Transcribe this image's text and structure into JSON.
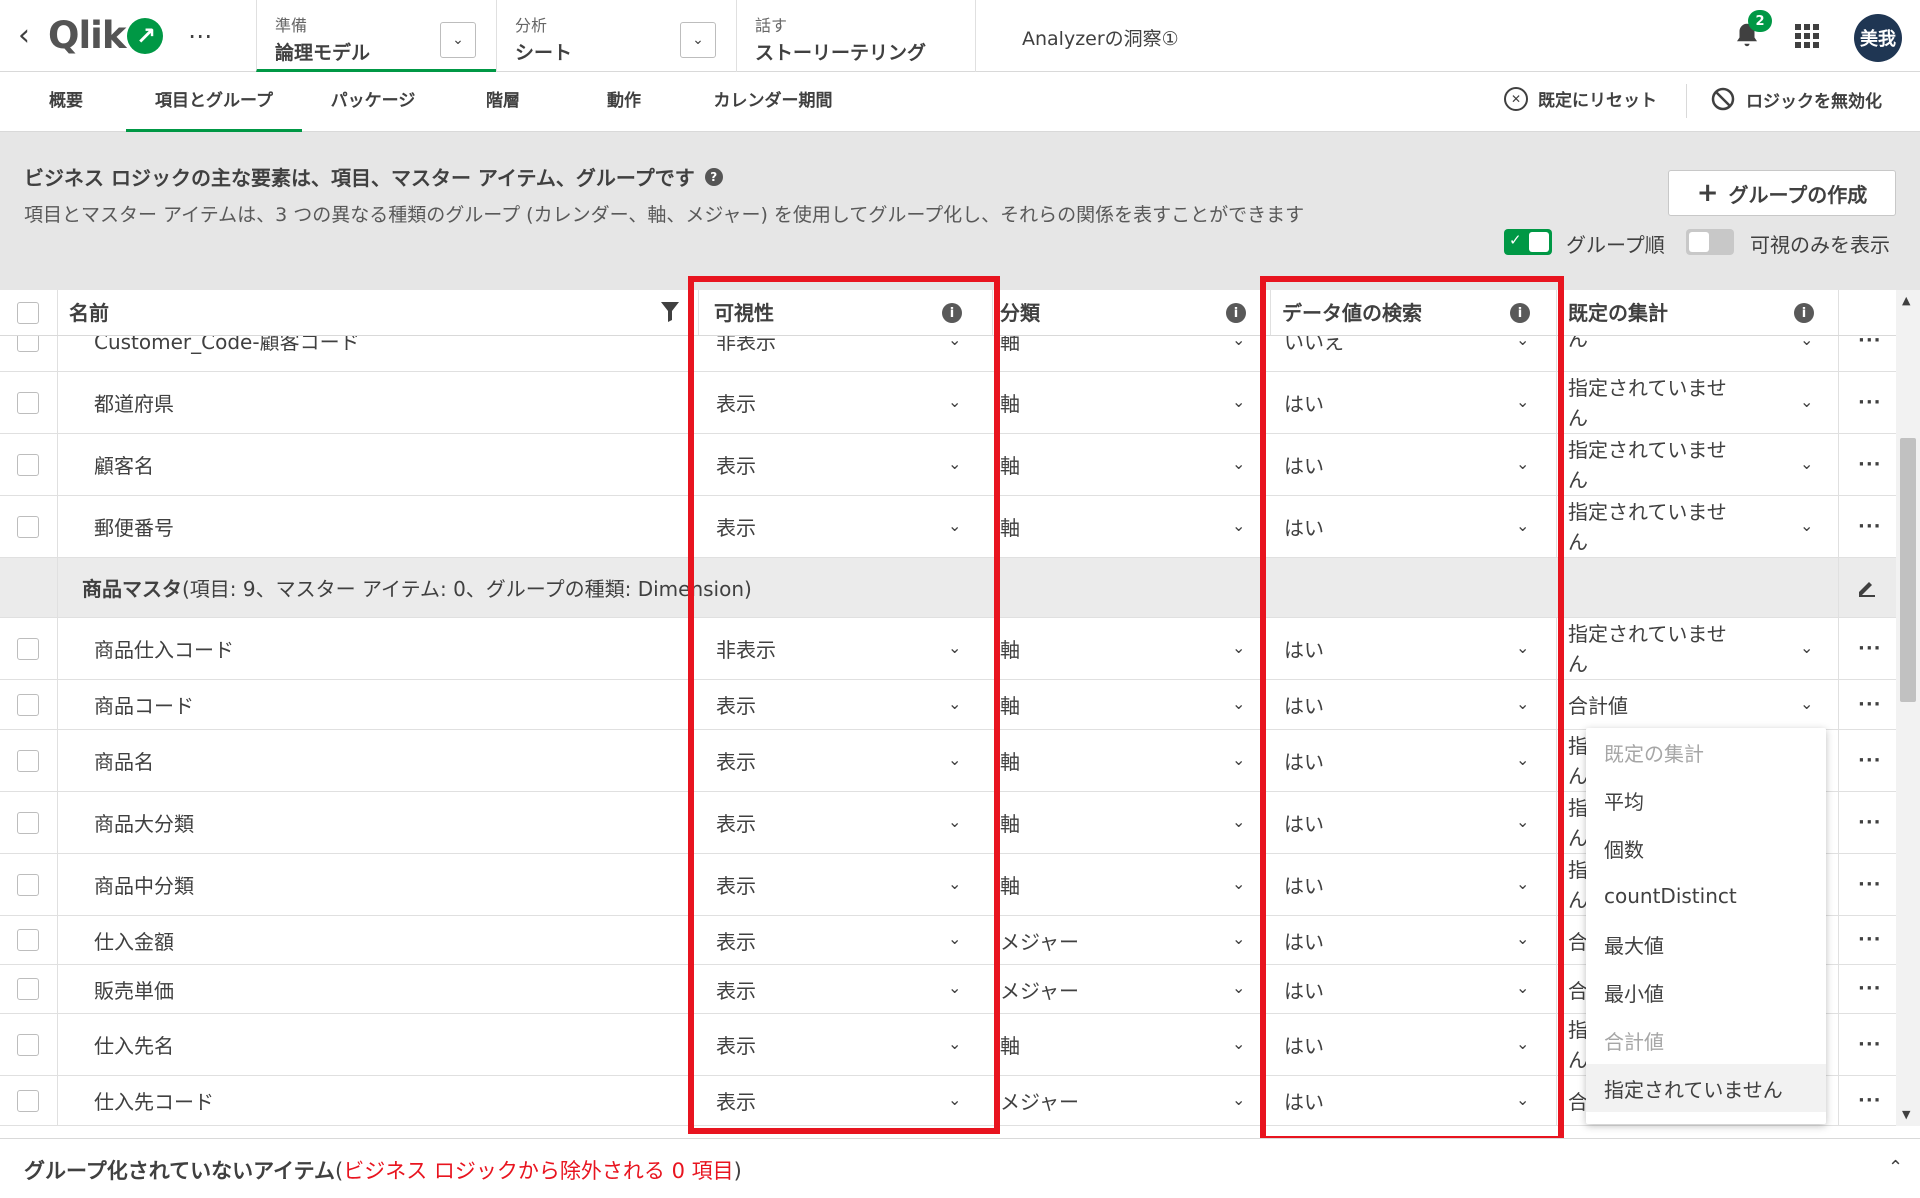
{
  "topbar": {
    "logo_text": "Qlik",
    "more": "⋯",
    "nav": [
      {
        "small": "準備",
        "big": "論理モデル"
      },
      {
        "small": "分析",
        "big": "シート"
      },
      {
        "small": "話す",
        "big": "ストーリーテリング"
      }
    ],
    "app_title": "Analyzerの洞察①",
    "notification_count": "2",
    "avatar": "美我"
  },
  "subtabs": [
    "概要",
    "項目とグループ",
    "パッケージ",
    "階層",
    "動作",
    "カレンダー期間"
  ],
  "actions": {
    "reset": "既定にリセット",
    "disable": "ロジックを無効化"
  },
  "info": {
    "title": "ビジネス ロジックの主な要素は、項目、マスター アイテム、グループです",
    "description": "項目とマスター アイテムは、3 つの異なる種類のグループ (カレンダー、軸、メジャー) を使用してグループ化し、それらの関係を表すことができます",
    "create_group": "グループの作成",
    "toggle_group_order": "グループ順",
    "toggle_visible_only": "可視のみを表示"
  },
  "columns": {
    "name": "名前",
    "visibility": "可視性",
    "classification": "分類",
    "search": "データ値の検索",
    "aggregation": "既定の集計"
  },
  "rows": [
    {
      "name": "Customer_Code-顧客コード",
      "vis": "非表示",
      "cls": "軸",
      "search": "いいえ",
      "agg": "ん"
    },
    {
      "name": "都道府県",
      "vis": "表示",
      "cls": "軸",
      "search": "はい",
      "agg": "指定されていませ\nん"
    },
    {
      "name": "顧客名",
      "vis": "表示",
      "cls": "軸",
      "search": "はい",
      "agg": "指定されていませ\nん"
    },
    {
      "name": "郵便番号",
      "vis": "表示",
      "cls": "軸",
      "search": "はい",
      "agg": "指定されていませ\nん"
    },
    {
      "group": true,
      "name": "商品マスタ",
      "detail": "(項目: 9、マスター アイテム: 0、グループの種類: Dimension)"
    },
    {
      "name": "商品仕入コード",
      "vis": "非表示",
      "cls": "軸",
      "search": "はい",
      "agg": "指定されていませ\nん"
    },
    {
      "name": "商品コード",
      "vis": "表示",
      "cls": "軸",
      "search": "はい",
      "agg": "合計値"
    },
    {
      "name": "商品名",
      "vis": "表示",
      "cls": "軸",
      "search": "はい",
      "agg": "指\nん"
    },
    {
      "name": "商品大分類",
      "vis": "表示",
      "cls": "軸",
      "search": "はい",
      "agg": "指\nん"
    },
    {
      "name": "商品中分類",
      "vis": "表示",
      "cls": "軸",
      "search": "はい",
      "agg": "指\nん"
    },
    {
      "name": "仕入金額",
      "vis": "表示",
      "cls": "メジャー",
      "search": "はい",
      "agg": "合"
    },
    {
      "name": "販売単価",
      "vis": "表示",
      "cls": "メジャー",
      "search": "はい",
      "agg": "合"
    },
    {
      "name": "仕入先名",
      "vis": "表示",
      "cls": "軸",
      "search": "はい",
      "agg": "指\nん"
    },
    {
      "name": "仕入先コード",
      "vis": "表示",
      "cls": "メジャー",
      "search": "はい",
      "agg": "合"
    }
  ],
  "agg_menu": [
    {
      "label": "既定の集計",
      "state": "header"
    },
    {
      "label": "平均",
      "state": "normal"
    },
    {
      "label": "個数",
      "state": "normal"
    },
    {
      "label": "countDistinct",
      "state": "normal"
    },
    {
      "label": "最大値",
      "state": "normal"
    },
    {
      "label": "最小値",
      "state": "normal"
    },
    {
      "label": "合計値",
      "state": "disabled"
    },
    {
      "label": "指定されていません",
      "state": "selected"
    }
  ],
  "footer": {
    "label": "グループ化されていないアイテム",
    "note": "ビジネス ロジックから除外される 0 項目"
  },
  "colors": {
    "accent": "#009845",
    "highlight": "#e8141f",
    "avatar": "#1f3653"
  }
}
